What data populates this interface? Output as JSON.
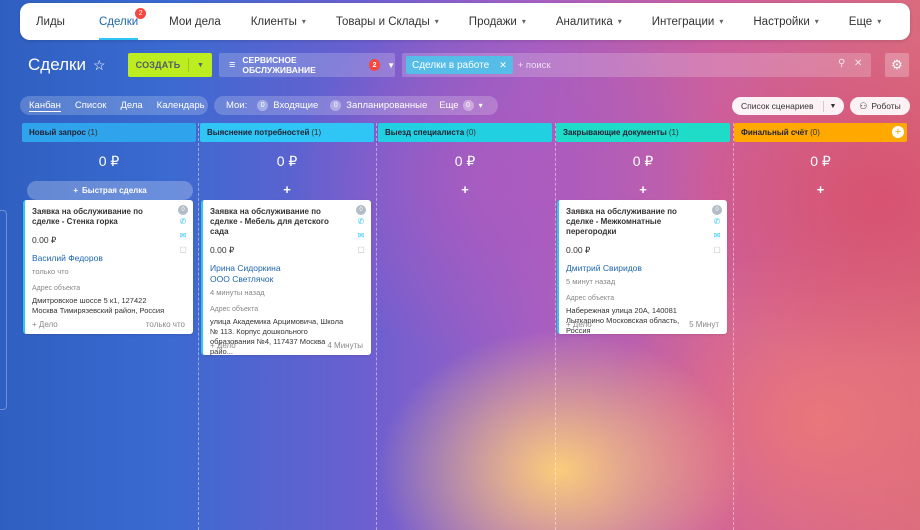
{
  "nav": {
    "items": [
      {
        "label": "Лиды",
        "chev": false,
        "active": false
      },
      {
        "label": "Сделки",
        "chev": false,
        "active": true,
        "badge": "2"
      },
      {
        "label": "Мои дела",
        "chev": false,
        "active": false
      },
      {
        "label": "Клиенты",
        "chev": true,
        "active": false
      },
      {
        "label": "Товары и Склады",
        "chev": true,
        "active": false
      },
      {
        "label": "Продажи",
        "chev": true,
        "active": false
      },
      {
        "label": "Аналитика",
        "chev": true,
        "active": false
      },
      {
        "label": "Интеграции",
        "chev": true,
        "active": false
      },
      {
        "label": "Настройки",
        "chev": true,
        "active": false
      },
      {
        "label": "Еще",
        "chev": true,
        "active": false
      }
    ]
  },
  "header": {
    "title": "Сделки",
    "create_label": "СОЗДАТЬ",
    "service_label": "СЕРВИСНОЕ ОБСЛУЖИВАНИЕ",
    "service_badge": "2"
  },
  "search": {
    "tag": "Сделки в работе",
    "placeholder": "+ поиск"
  },
  "views": {
    "items": [
      "Канбан",
      "Список",
      "Дела",
      "Календарь"
    ],
    "active": "Канбан"
  },
  "mine": {
    "label": "Мои:",
    "incoming_count": "0",
    "incoming": "Входящие",
    "planned_count": "0",
    "planned": "Запланированные",
    "more": "Еще",
    "more_count": "0"
  },
  "scenarios_label": "Список сценариев",
  "robots_label": "Роботы",
  "quick_deal": "Быстрая сделка",
  "columns": [
    {
      "name": "Новый запрос",
      "count": "(1)",
      "color": "#2fa4ed",
      "sum": "0 ₽"
    },
    {
      "name": "Выяснение потребностей",
      "count": "(1)",
      "color": "#2fc6f6",
      "sum": "0 ₽"
    },
    {
      "name": "Выезд специалиста",
      "count": "(0)",
      "color": "#21d1e1",
      "sum": "0 ₽"
    },
    {
      "name": "Закрывающие документы",
      "count": "(1)",
      "color": "#1fdcc8",
      "sum": "0 ₽"
    },
    {
      "name": "Финальный счёт",
      "count": "(0)",
      "color": "#ffa900",
      "sum": "0 ₽"
    }
  ],
  "cards": [
    {
      "title": "Заявка на обслуживание по сделке - Стенка горка",
      "price": "0.00 ₽",
      "client": "Василий Федоров",
      "company": "",
      "time": "только что",
      "addr_label": "Адрес объекта",
      "address": "Дмитровское шоссе 5 к1, 127422 Москва Тимирязевский район, Россия",
      "add": "+ Дело",
      "footer_time": "только что",
      "num": "0"
    },
    {
      "title": "Заявка на обслуживание по сделке - Мебель для детского сада",
      "price": "0.00 ₽",
      "client": "Ирина Сидоркина",
      "company": "ООО Светлячок",
      "time": "4 минуты назад",
      "addr_label": "Адрес объекта",
      "address": "улица Академика Арцимовича, Школа № 113. Корпус дошкольного образования №4, 117437 Москва райо...",
      "add": "+ Дело",
      "footer_time": "4 Минуты",
      "num": "0"
    },
    {
      "title": "Заявка на обслуживание по сделке - Межкомнатные перегородки",
      "price": "0.00 ₽",
      "client": "Дмитрий Свиридов",
      "company": "",
      "time": "5 минут назад",
      "addr_label": "Адрес объекта",
      "address": "Набережная улица 20А, 140081 Лыткарино Московская область, Россия",
      "add": "+ Дело",
      "footer_time": "5 Минут",
      "num": "0"
    }
  ]
}
